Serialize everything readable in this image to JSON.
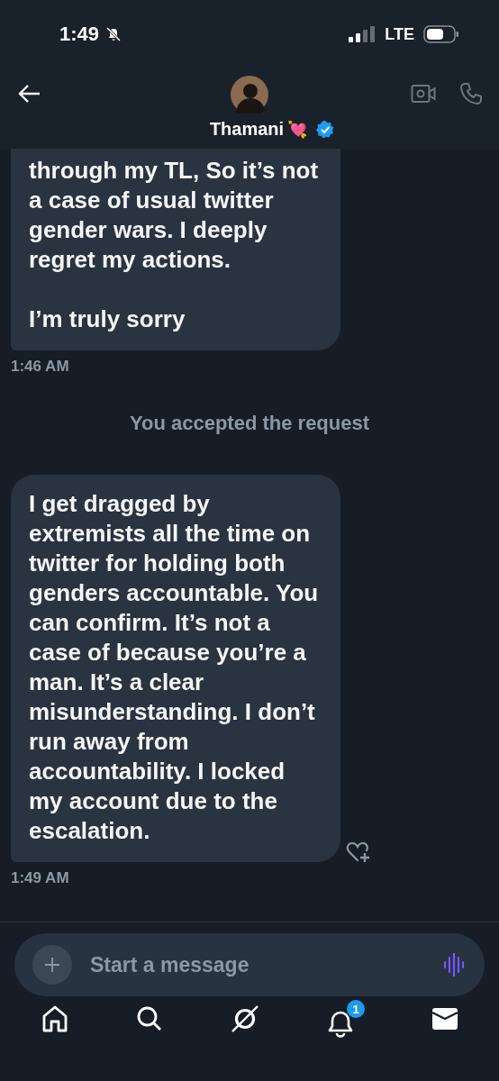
{
  "status_bar": {
    "time": "1:49",
    "network": "LTE"
  },
  "header": {
    "name": "Thamani",
    "emoji": "💘",
    "verified": true
  },
  "messages": [
    {
      "kind": "message",
      "paragraphs": [
        "through my TL, So it’s not a case of usual twitter gender wars. I deeply regret my actions.",
        "I’m truly sorry"
      ],
      "time": "1:46 AM",
      "cut_top": true
    },
    {
      "kind": "notice",
      "text": "You accepted the request"
    },
    {
      "kind": "message",
      "paragraphs": [
        "I get dragged by extremists all the time on twitter for holding both genders accountable. You can confirm. It’s not a case of because you’re a man. It’s a clear misunderstanding. I don’t run away from accountability. I locked my account due to the escalation."
      ],
      "time": "1:49 AM",
      "cut_top": false,
      "react": true
    }
  ],
  "composer": {
    "placeholder": "Start a message"
  },
  "nav": [
    {
      "kind": "home"
    },
    {
      "kind": "search"
    },
    {
      "kind": "grok"
    },
    {
      "kind": "bell",
      "badge": "1"
    },
    {
      "kind": "mail"
    }
  ]
}
